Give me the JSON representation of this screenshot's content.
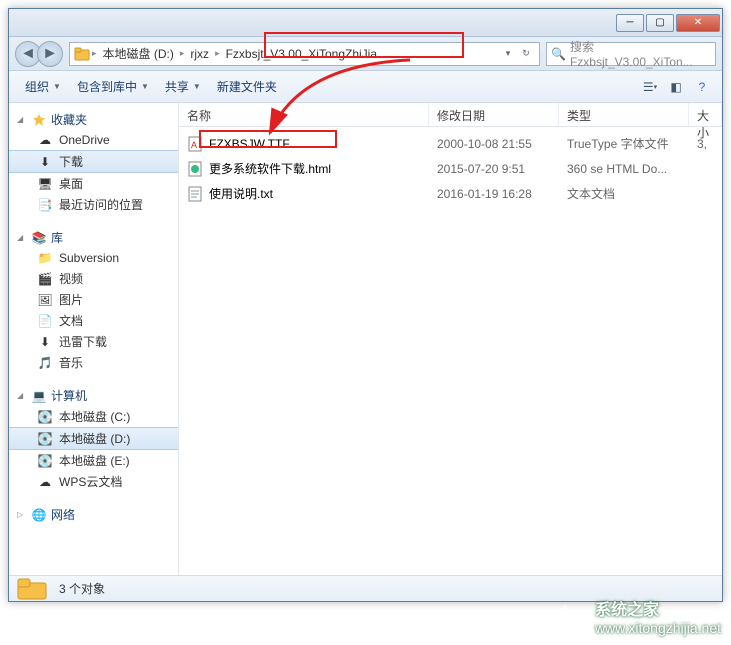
{
  "window": {
    "min": "─",
    "max": "▢",
    "close": "✕"
  },
  "address": {
    "crumbs": [
      "本地磁盘 (D:)",
      "rjxz",
      "Fzxbsjt_V3.00_XiTongZhiJia"
    ],
    "search_placeholder": "搜索 Fzxbsjt_V3.00_XiTon..."
  },
  "toolbar": {
    "organize": "组织",
    "include": "包含到库中",
    "share": "共享",
    "newfolder": "新建文件夹"
  },
  "nav": {
    "favorites": {
      "label": "收藏夹",
      "items": [
        "OneDrive",
        "下载",
        "桌面",
        "最近访问的位置"
      ],
      "selected": 1
    },
    "libraries": {
      "label": "库",
      "items": [
        "Subversion",
        "视频",
        "图片",
        "文档",
        "迅雷下载",
        "音乐"
      ]
    },
    "computer": {
      "label": "计算机",
      "items": [
        "本地磁盘 (C:)",
        "本地磁盘 (D:)",
        "本地磁盘 (E:)",
        "WPS云文档"
      ],
      "selected": 1
    },
    "network": {
      "label": "网络"
    }
  },
  "columns": {
    "name": "名称",
    "date": "修改日期",
    "type": "类型",
    "size": "大小"
  },
  "files": [
    {
      "name": "FZXBSJW.TTF",
      "date": "2000-10-08 21:55",
      "type": "TrueType 字体文件",
      "size": "3,",
      "icon": "font"
    },
    {
      "name": "更多系统软件下载.html",
      "date": "2015-07-20 9:51",
      "type": "360 se HTML Do...",
      "size": "",
      "icon": "html"
    },
    {
      "name": "使用说明.txt",
      "date": "2016-01-19 16:28",
      "type": "文本文档",
      "size": "",
      "icon": "txt"
    }
  ],
  "status": {
    "count": "3 个对象"
  },
  "watermark": {
    "cn": "系统之家",
    "url": "www.xitongzhijia.net"
  }
}
